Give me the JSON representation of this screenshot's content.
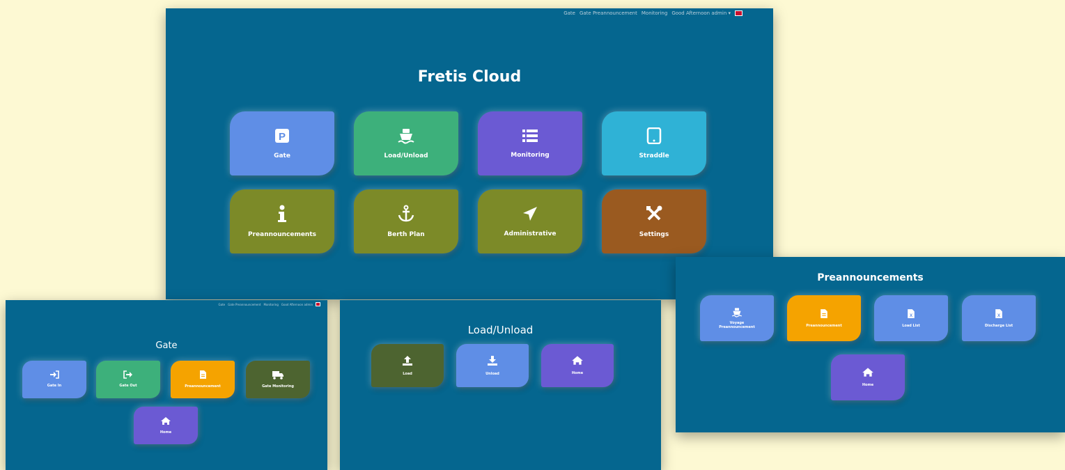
{
  "colors": {
    "background": "#fdf9d3",
    "panel": "#05668f",
    "blue": "#5f8ee6",
    "green": "#3db07b",
    "purple": "#6b5ad3",
    "cyan": "#2fb2d6",
    "olive": "#7c8a28",
    "brown": "#9a5a20",
    "orange": "#f5a300",
    "dark_olive": "#4d6430"
  },
  "main": {
    "nav": [
      "Gate",
      "Gate Preannouncement",
      "Monitoring",
      "Good Afternoon admin ▾"
    ],
    "title": "Fretis Cloud",
    "tiles": [
      {
        "label": "Gate",
        "icon": "parking-icon"
      },
      {
        "label": "Load/Unload",
        "icon": "ship-icon"
      },
      {
        "label": "Monitoring",
        "icon": "list-icon"
      },
      {
        "label": "Straddle",
        "icon": "tablet-icon"
      },
      {
        "label": "Preannouncements",
        "icon": "info-icon"
      },
      {
        "label": "Berth Plan",
        "icon": "anchor-icon"
      },
      {
        "label": "Administrative",
        "icon": "paper-plane-icon"
      },
      {
        "label": "Settings",
        "icon": "tools-icon"
      }
    ]
  },
  "gate_screen": {
    "nav": [
      "Gate",
      "Gate Preannouncement",
      "Monitoring",
      "Good Afternoon admin"
    ],
    "title": "Gate",
    "tiles": [
      {
        "label": "Gate In",
        "icon": "sign-in-icon"
      },
      {
        "label": "Gate Out",
        "icon": "sign-out-icon"
      },
      {
        "label": "Preannouncement",
        "icon": "document-icon"
      },
      {
        "label": "Gate Monitoring",
        "icon": "truck-icon"
      },
      {
        "label": "Home",
        "icon": "home-icon"
      }
    ]
  },
  "load_unload_screen": {
    "title": "Load/Unload",
    "tiles": [
      {
        "label": "Load",
        "icon": "upload-icon"
      },
      {
        "label": "Unload",
        "icon": "download-icon"
      },
      {
        "label": "Home",
        "icon": "home-icon"
      }
    ]
  },
  "preannouncements_screen": {
    "title": "Preannouncements",
    "tiles": [
      {
        "label": "Voyage Preannouncement",
        "icon": "ship-icon"
      },
      {
        "label": "Preannouncement",
        "icon": "document-icon"
      },
      {
        "label": "Load List",
        "icon": "excel-file-icon"
      },
      {
        "label": "Discharge List",
        "icon": "excel-file-icon"
      },
      {
        "label": "Home",
        "icon": "home-icon"
      }
    ]
  }
}
